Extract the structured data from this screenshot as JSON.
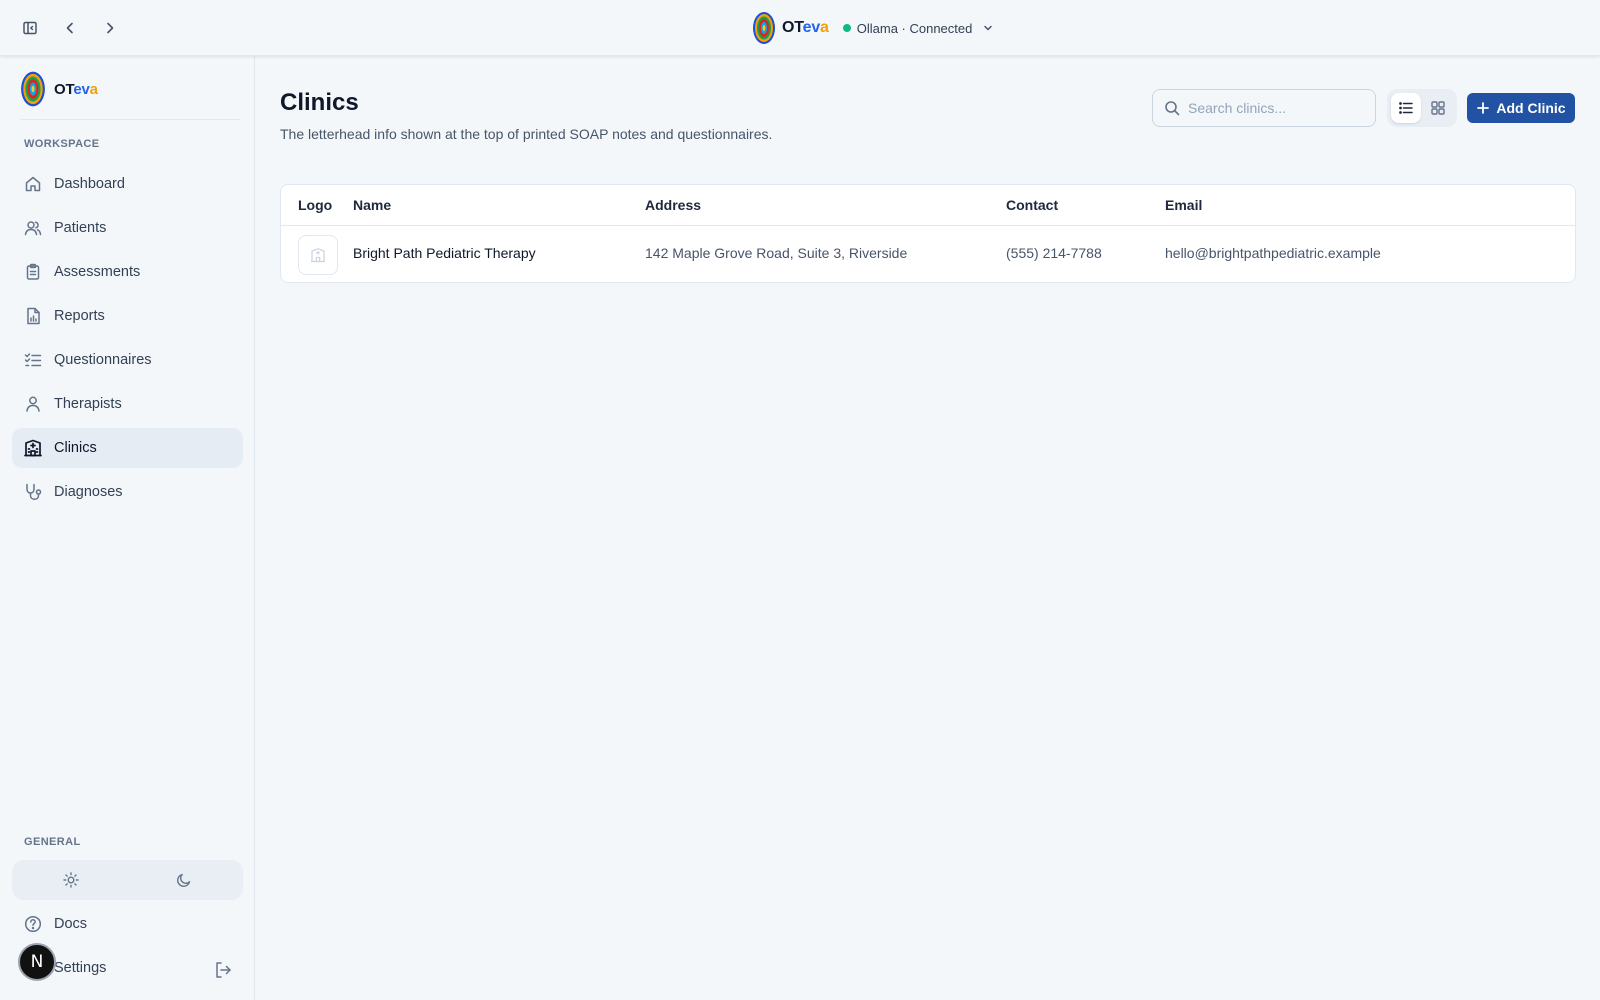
{
  "app": {
    "brand_parts": [
      "OT",
      "ev",
      "a"
    ],
    "brand_colors": [
      "#0f172a",
      "#2563eb",
      "#f59e0b"
    ],
    "status_text": "Ollama · Connected",
    "status_color": "#10b981"
  },
  "topbar": {
    "icons": [
      "sidebar-toggle-icon",
      "chevron-left-icon",
      "chevron-right-icon",
      "chevron-down-icon"
    ]
  },
  "sidebar": {
    "workspace_label": "WORKSPACE",
    "items": [
      {
        "label": "Dashboard",
        "icon": "home-icon"
      },
      {
        "label": "Patients",
        "icon": "users-icon"
      },
      {
        "label": "Assessments",
        "icon": "clipboard-icon"
      },
      {
        "label": "Reports",
        "icon": "file-chart-icon"
      },
      {
        "label": "Questionnaires",
        "icon": "list-checks-icon"
      },
      {
        "label": "Therapists",
        "icon": "user-icon"
      },
      {
        "label": "Clinics",
        "icon": "hospital-icon",
        "active": true
      },
      {
        "label": "Diagnoses",
        "icon": "stethoscope-icon"
      }
    ],
    "general_label": "GENERAL",
    "docs_label": "Docs",
    "settings_label": "Settings",
    "avatar_letter": "N"
  },
  "main": {
    "title": "Clinics",
    "subtitle": "The letterhead info shown at the top of printed SOAP notes and questionnaires.",
    "search_placeholder": "Search clinics...",
    "add_button_label": "Add Clinic",
    "accent_color": "#2152a3"
  },
  "table": {
    "columns": [
      "Logo",
      "Name",
      "Address",
      "Contact",
      "Email"
    ],
    "rows": [
      {
        "name": "Bright Path Pediatric Therapy",
        "address": "142 Maple Grove Road, Suite 3, Riverside",
        "contact": "(555) 214-7788",
        "email": "hello@brightpathpediatric.example"
      }
    ]
  }
}
